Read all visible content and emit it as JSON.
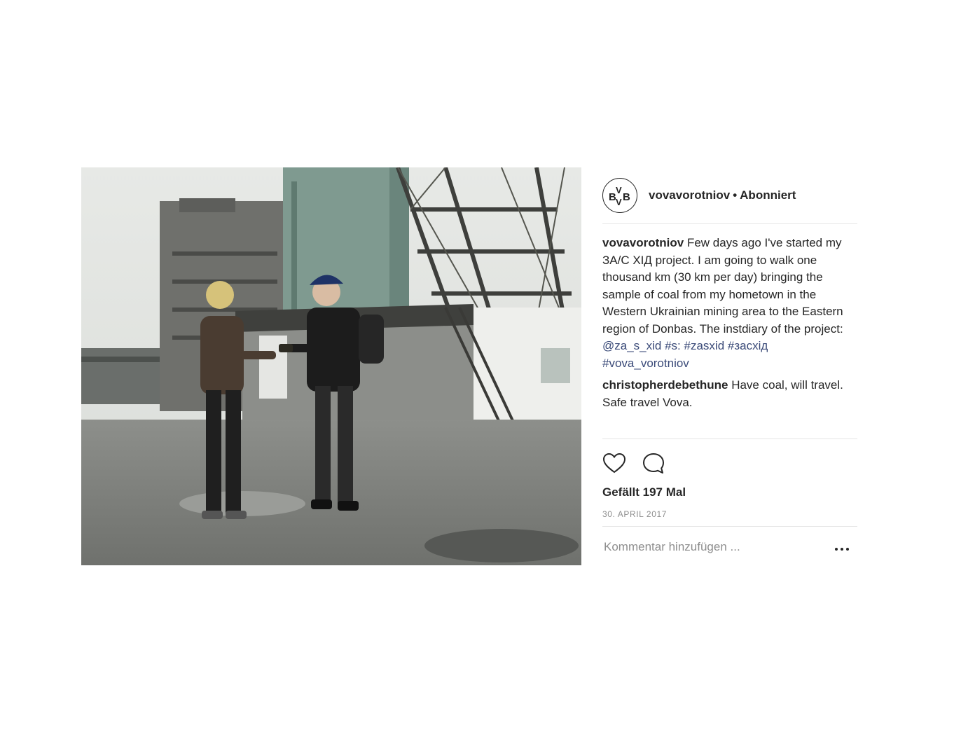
{
  "post": {
    "image": {
      "alt": ""
    },
    "header": {
      "avatar_text": "BVVB",
      "username": "vovavorotniov",
      "separator": "•",
      "follow_status": "Abonniert"
    },
    "comments": [
      {
        "username": "vovavorotniov",
        "text": "Few days ago I've started my ЗА/С ХІД project. I am going to walk one thousand km (30 km per day) bringing the sample of coal from my hometown in the Western Ukrainian mining area to the Eastern region of Donbas. The instdiary of the project:",
        "mentions": [
          "@za_s_xid",
          "#s:",
          "#zasxid",
          "#засхід",
          "#vova_vorotniov"
        ]
      },
      {
        "username": "christopherdebethune",
        "text": "Have coal, will travel.",
        "text2": "Safe travel Vova."
      }
    ],
    "actions": {
      "like_icon": "heart-icon",
      "comment_icon": "comment-bubble-icon"
    },
    "likes": "Gefällt 197 Mal",
    "date": "30. APRIL 2017",
    "add_comment": {
      "placeholder": "Kommentar hinzufügen ...",
      "more_icon": "more-options-icon"
    }
  }
}
